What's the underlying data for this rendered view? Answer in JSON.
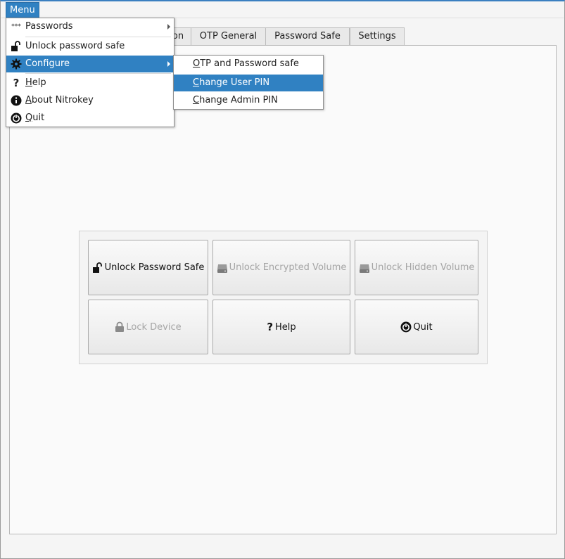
{
  "menubar": {
    "menu_label": "Menu"
  },
  "tabs": [
    {
      "label": "on"
    },
    {
      "label": "OTP General"
    },
    {
      "label": "Password Safe"
    },
    {
      "label": "Settings"
    }
  ],
  "main_menu": {
    "items": [
      {
        "label": "Passwords",
        "icon": "dots-icon",
        "has_submenu": true
      },
      {
        "label": "Unlock password safe",
        "icon": "padlock-open-icon"
      },
      {
        "label": "Configure",
        "icon": "gear-icon",
        "has_submenu": true,
        "highlighted": true
      },
      {
        "label_first": "H",
        "label_rest": "elp",
        "icon": "question-icon"
      },
      {
        "label_first": "A",
        "label_rest": "bout Nitrokey",
        "icon": "info-icon"
      },
      {
        "label_first": "Q",
        "label_rest": "uit",
        "icon": "power-icon"
      }
    ]
  },
  "configure_submenu": {
    "items": [
      {
        "label_first": "O",
        "label_rest": "TP and Password safe"
      },
      {
        "label_first": "C",
        "label_rest": "hange User PIN",
        "highlighted": true
      },
      {
        "label_first": "C",
        "label_rest": "hange Admin PIN"
      }
    ]
  },
  "buttons": {
    "unlock_password_safe": "Unlock Password Safe",
    "unlock_encrypted_volume": "Unlock Encrypted Volume",
    "unlock_hidden_volume": "Unlock Hidden Volume",
    "lock_device": "Lock Device",
    "help": "Help",
    "quit": "Quit"
  },
  "colors": {
    "highlight": "#3081c2",
    "disabled_text": "#a5a5a5"
  }
}
